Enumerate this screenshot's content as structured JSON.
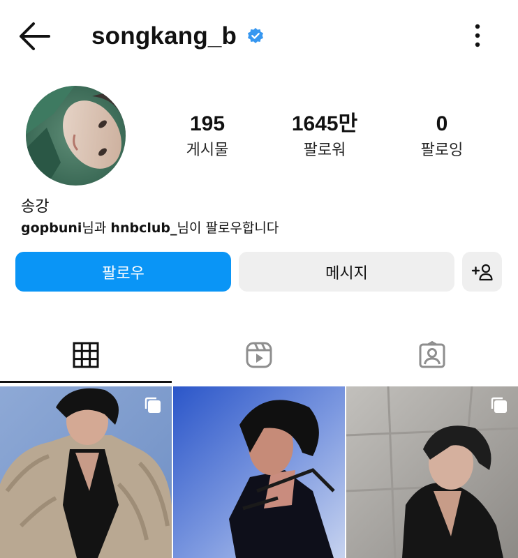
{
  "header": {
    "username": "songkang_b",
    "verified": true,
    "back_icon": "arrow-left-icon",
    "more_icon": "more-vertical-icon"
  },
  "profile": {
    "stats": [
      {
        "value": "195",
        "label": "게시물"
      },
      {
        "value": "1645만",
        "label": "팔로워"
      },
      {
        "value": "0",
        "label": "팔로잉"
      }
    ],
    "name": "송강",
    "followed_by": {
      "user1": "gopbuni",
      "joiner": "님과 ",
      "user2": "hnbclub_",
      "suffix": "님이 팔로우합니다"
    }
  },
  "actions": {
    "follow_label": "팔로우",
    "message_label": "메시지",
    "add_user_icon": "add-user-icon"
  },
  "tabs": [
    {
      "icon": "grid-icon",
      "active": true
    },
    {
      "icon": "reels-icon",
      "active": false
    },
    {
      "icon": "tagged-icon",
      "active": false
    }
  ],
  "posts": [
    {
      "type": "carousel",
      "icon": "multiple-posts-icon"
    },
    {
      "type": "single"
    },
    {
      "type": "carousel",
      "icon": "multiple-posts-icon"
    }
  ],
  "colors": {
    "accent": "#0a95f6",
    "verified": "#3797f0",
    "button_secondary": "#efefef"
  }
}
